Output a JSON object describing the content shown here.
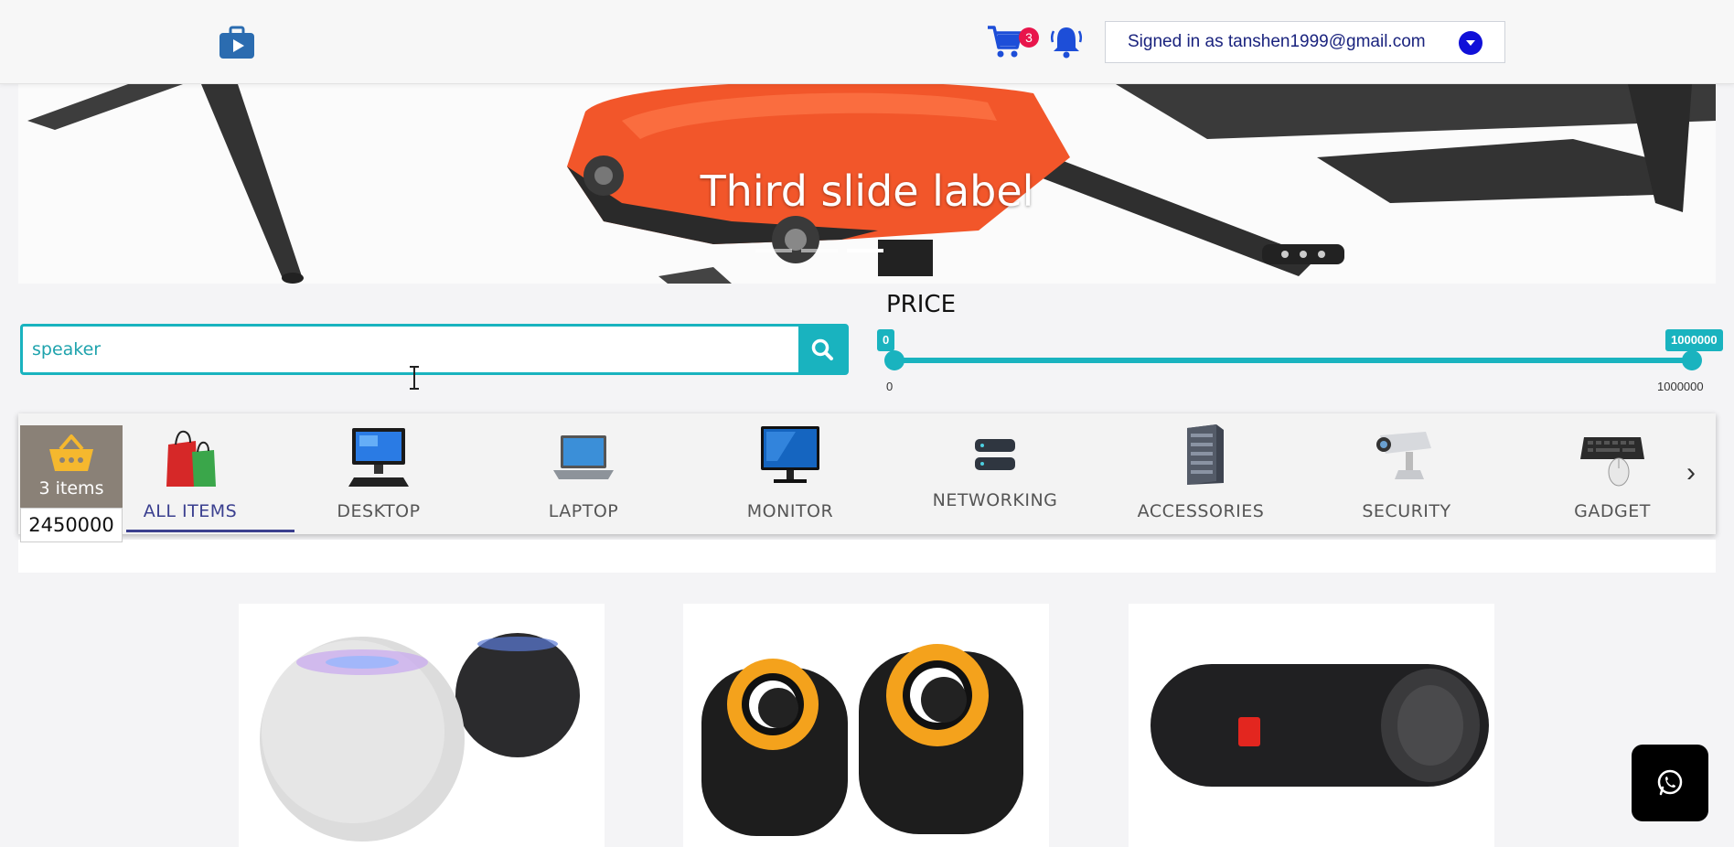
{
  "header": {
    "cart_count": "3",
    "account_label": "Signed in as tanshen1999@gmail.com"
  },
  "hero": {
    "slide_label": "Third slide label"
  },
  "search": {
    "value": "speaker"
  },
  "price": {
    "title": "PRICE",
    "min_value": "0",
    "max_value": "1000000",
    "min_tick": "0",
    "max_tick": "1000000",
    "min_fraction": 0,
    "max_fraction": 1
  },
  "basket": {
    "count_label": "3 items",
    "total": "2450000"
  },
  "categories": [
    {
      "label": "ALL ITEMS",
      "icon": "shopping-bags-icon"
    },
    {
      "label": "DESKTOP",
      "icon": "desktop-icon"
    },
    {
      "label": "LAPTOP",
      "icon": "laptop-icon"
    },
    {
      "label": "MONITOR",
      "icon": "monitor-icon"
    },
    {
      "label": "NETWORKING",
      "icon": "router-icon"
    },
    {
      "label": "ACCESSORIES",
      "icon": "server-icon"
    },
    {
      "label": "SECURITY",
      "icon": "cctv-camera-icon"
    },
    {
      "label": "GADGET",
      "icon": "keyboard-mouse-icon"
    }
  ],
  "colors": {
    "accent": "#19b3bf",
    "cart_badge": "#e8154b",
    "account_text": "#1a237e",
    "hero_drone": "#f2562a"
  }
}
